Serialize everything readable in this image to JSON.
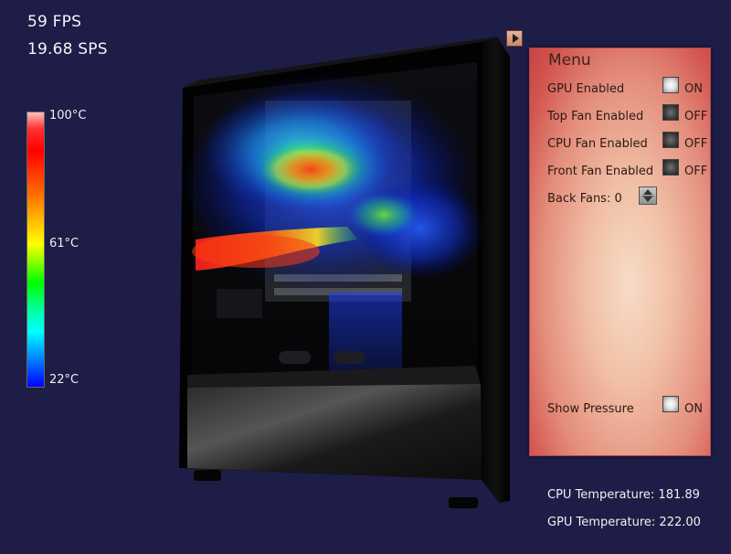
{
  "hud": {
    "fps": "59 FPS",
    "sps": "19.68 SPS"
  },
  "legend": {
    "max_label": "100°C",
    "mid_label": "61°C",
    "min_label": "22°C"
  },
  "menu": {
    "title": "Menu",
    "collapse_icon": "triangle-right-icon",
    "gpu": {
      "label": "GPU Enabled",
      "state": "ON"
    },
    "top_fan": {
      "label": "Top Fan Enabled",
      "state": "OFF"
    },
    "cpu_fan": {
      "label": "CPU Fan Enabled",
      "state": "OFF"
    },
    "front_fan": {
      "label": "Front Fan Enabled",
      "state": "OFF"
    },
    "back_fans": {
      "label": "Back Fans: 0",
      "value": 0
    },
    "pressure": {
      "label": "Show Pressure",
      "state": "ON"
    }
  },
  "readouts": {
    "cpu_temperature": "CPU Temperature: 181.89",
    "gpu_temperature": "GPU Temperature: 222.00"
  },
  "colors": {
    "background": "#1d1d47",
    "panel_edge": "#c84343",
    "panel_center": "#f7dcc8"
  }
}
